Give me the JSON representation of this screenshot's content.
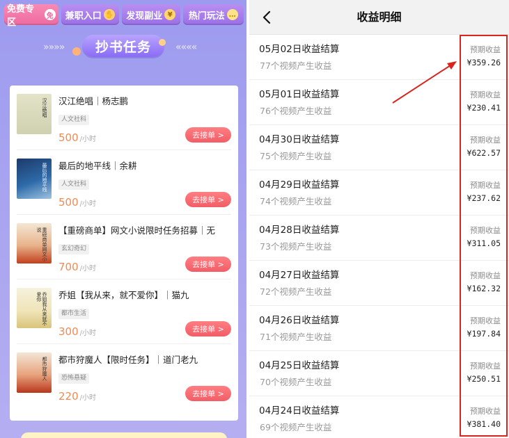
{
  "left": {
    "nav": [
      {
        "label": "免费专区",
        "icon": "免"
      },
      {
        "label": "兼职入口",
        "icon": "✋"
      },
      {
        "label": "发现副业",
        "icon": "¥"
      },
      {
        "label": "热门玩法",
        "icon": "…"
      }
    ],
    "banner_title": "抄书任务",
    "tasks": [
      {
        "title": "汉江绝唱｜杨志鹏",
        "tag": "人文社科",
        "price": "500",
        "unit": "/小时",
        "button": "去接单 >",
        "cover_text": "汉江绝唱"
      },
      {
        "title": "最后的地平线｜余耕",
        "tag": "人文社科",
        "price": "500",
        "unit": "/小时",
        "button": "去接单 >",
        "cover_text": "最后的地平线"
      },
      {
        "title": "【重磅商单】网文小说限时任务招募｜无",
        "tag": "玄幻奇幻",
        "price": "700",
        "unit": "/小时",
        "button": "去接单 >",
        "cover_text": "重磅商单网文小说"
      },
      {
        "title": "乔姐【我从来，就不爱你】｜猫九",
        "tag": "都市生活",
        "price": "300",
        "unit": "/小时",
        "button": "去接单 >",
        "cover_text": "乔姐我从来就不爱你"
      },
      {
        "title": "都市狩魔人【限时任务】｜道门老九",
        "tag": "恐怖悬疑",
        "price": "220",
        "unit": "/小时",
        "button": "去接单 >",
        "cover_text": "都市狩魔人"
      }
    ],
    "colors": {
      "accent": "#f25d67",
      "price": "#f08a52",
      "bg": "#a8a4f0"
    }
  },
  "right": {
    "title": "收益明细",
    "back_icon": "chevron-left-icon",
    "rows": [
      {
        "title": "05月02日收益结算",
        "sub": "77个视频产生收益",
        "label": "预期收益",
        "amount": "¥359.26"
      },
      {
        "title": "05月01日收益结算",
        "sub": "76个视频产生收益",
        "label": "预期收益",
        "amount": "¥230.41"
      },
      {
        "title": "04月30日收益结算",
        "sub": "75个视频产生收益",
        "label": "预期收益",
        "amount": "¥622.57"
      },
      {
        "title": "04月29日收益结算",
        "sub": "74个视频产生收益",
        "label": "预期收益",
        "amount": "¥237.62"
      },
      {
        "title": "04月28日收益结算",
        "sub": "73个视频产生收益",
        "label": "预期收益",
        "amount": "¥311.05"
      },
      {
        "title": "04月27日收益结算",
        "sub": "72个视频产生收益",
        "label": "预期收益",
        "amount": "¥162.32"
      },
      {
        "title": "04月26日收益结算",
        "sub": "71个视频产生收益",
        "label": "预期收益",
        "amount": "¥197.84"
      },
      {
        "title": "04月25日收益结算",
        "sub": "70个视频产生收益",
        "label": "预期收益",
        "amount": "¥250.51"
      },
      {
        "title": "04月24日收益结算",
        "sub": "69个视频产生收益",
        "label": "预期收益",
        "amount": "¥381.40"
      }
    ],
    "colors": {
      "highlight": "#d8261f"
    }
  }
}
